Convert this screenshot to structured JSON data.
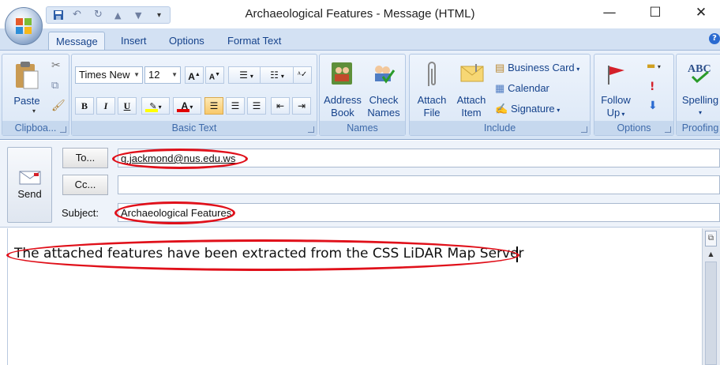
{
  "window": {
    "title": "Archaeological Features - Message (HTML)",
    "minimize": "—",
    "maximize": "☐",
    "close": "✕"
  },
  "quick_access": {
    "items": [
      "save-icon",
      "undo-icon",
      "redo-icon",
      "up-icon",
      "down-icon",
      "customize-icon"
    ]
  },
  "tabs": [
    {
      "label": "Message",
      "active": true
    },
    {
      "label": "Insert"
    },
    {
      "label": "Options"
    },
    {
      "label": "Format Text"
    }
  ],
  "help": "?",
  "ribbon": {
    "clipboard": {
      "name": "Clipboa...",
      "paste": "Paste"
    },
    "basic_text": {
      "name": "Basic Text",
      "font": "Times New",
      "size": "12",
      "grow": "A",
      "shrink": "A",
      "bold": "B",
      "italic": "I",
      "underline": "U",
      "font_color": "A",
      "highlight_color": "#ffff00",
      "font_color_value": "#e00000"
    },
    "names": {
      "name": "Names",
      "address_book": [
        "Address",
        "Book"
      ],
      "check_names": [
        "Check",
        "Names"
      ]
    },
    "include": {
      "name": "Include",
      "attach_file": [
        "Attach",
        "File"
      ],
      "attach_item": [
        "Attach",
        "Item"
      ],
      "business_card": "Business Card",
      "calendar": "Calendar",
      "signature": "Signature"
    },
    "options": {
      "name": "Options",
      "follow_up": [
        "Follow",
        "Up"
      ]
    },
    "proofing": {
      "name": "Proofing",
      "spelling": "Spelling"
    }
  },
  "compose": {
    "send": "Send",
    "to_label": "To...",
    "cc_label": "Cc...",
    "subject_label": "Subject:",
    "to_value": "g.jackmond@nus.edu.ws",
    "cc_value": "",
    "subject_value": "Archaeological Features",
    "body_text": "The attached features have been extracted from the CSS LiDAR Map Server"
  },
  "annotation_color": "#e0101a"
}
